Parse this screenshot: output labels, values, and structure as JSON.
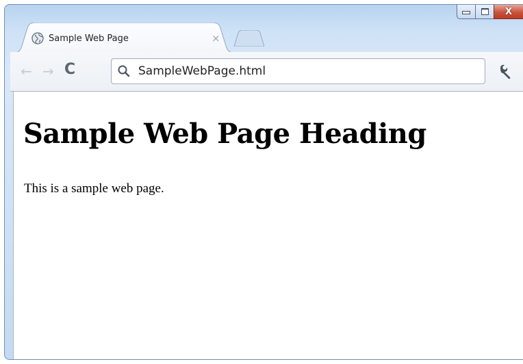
{
  "window": {
    "caption_buttons": {
      "minimize": "minimize-icon",
      "maximize": "maximize-icon",
      "close_label": "X"
    }
  },
  "tab": {
    "icon": "globe-icon",
    "title": "Sample Web Page",
    "close_label": "×"
  },
  "toolbar": {
    "back_label": "←",
    "forward_label": "→",
    "reload_label": "C",
    "omnibox_value": "SampleWebPage.html",
    "search_icon": "search-icon",
    "wrench_icon": "wrench-icon"
  },
  "page": {
    "heading": "Sample Web Page Heading",
    "paragraph": "This is a sample web page."
  },
  "colors": {
    "frame": "#cfe2f6",
    "close_button": "#c9543d",
    "content_bg": "#ffffff"
  }
}
